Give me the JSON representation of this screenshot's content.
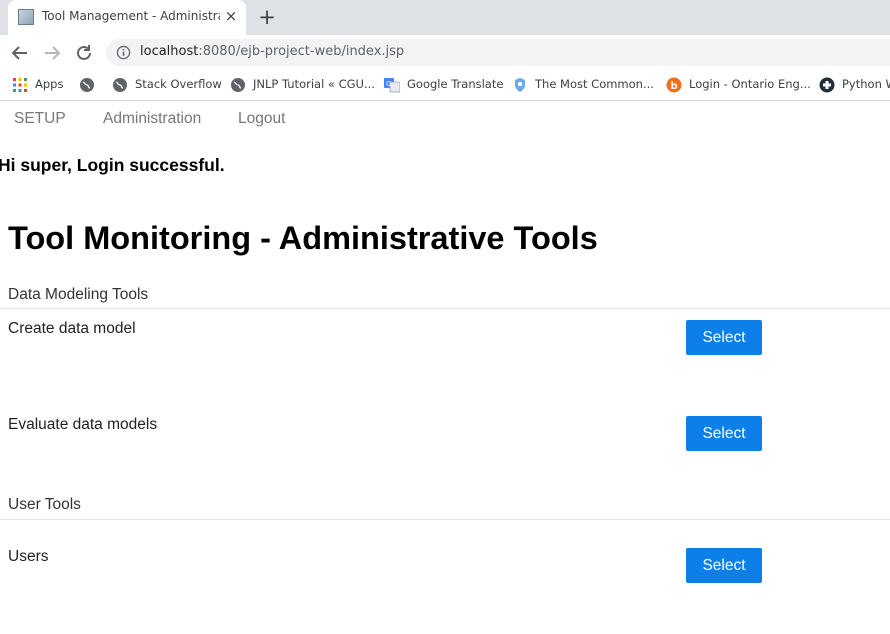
{
  "browser": {
    "tab": {
      "title": "Tool Management - Administrati",
      "favicon": "page-favicon-icon",
      "close": "×"
    },
    "new_tab": "+",
    "url": {
      "host": "localhost",
      "rest": ":8080/ejb-project-web/index.jsp"
    },
    "bookmarks": [
      {
        "label": "Apps",
        "icon": "apps-grid-icon"
      },
      {
        "label": "",
        "icon": "globe-icon"
      },
      {
        "label": "Stack Overflow",
        "icon": "globe-icon"
      },
      {
        "label": "JNLP Tutorial « CGU...",
        "icon": "globe-icon"
      },
      {
        "label": "Google Translate",
        "icon": "google-translate-icon"
      },
      {
        "label": "The Most Common...",
        "icon": "shield-icon"
      },
      {
        "label": "Login - Ontario Eng...",
        "icon": "orange-circle-icon"
      },
      {
        "label": "Python W",
        "icon": "python-icon"
      }
    ]
  },
  "nav": {
    "items": [
      "SETUP",
      "Administration",
      "Logout"
    ]
  },
  "welcome": "Hi super, Login successful.",
  "heading": "Tool Monitoring - Administrative Tools",
  "sections": [
    {
      "title": "Data Modeling Tools",
      "tools": [
        {
          "label": "Create data model",
          "button": "Select"
        },
        {
          "label": "Evaluate data models",
          "button": "Select"
        }
      ]
    },
    {
      "title": "User Tools",
      "tools": [
        {
          "label": "Users",
          "button": "Select"
        }
      ]
    }
  ],
  "colors": {
    "accent": "#0d7fe8",
    "tabstrip": "#dee1e6",
    "nav_text": "#777777"
  }
}
